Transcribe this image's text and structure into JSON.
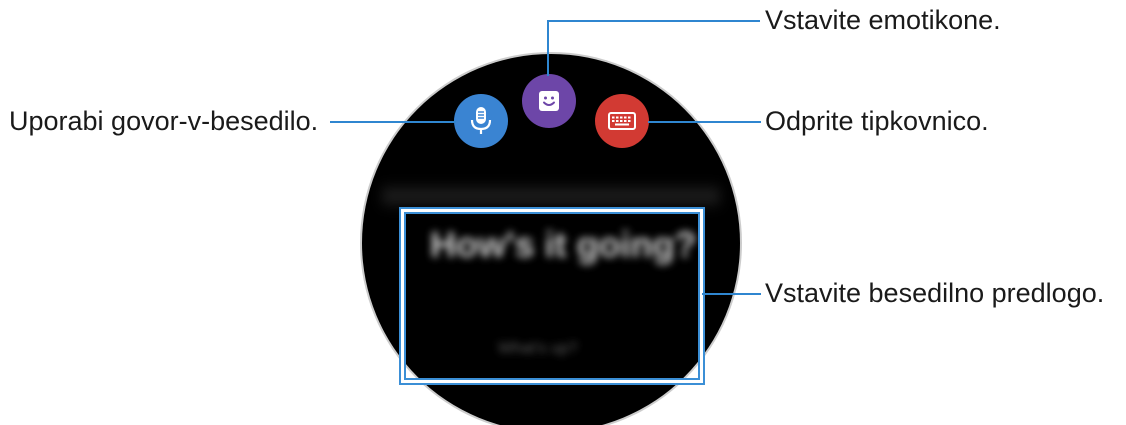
{
  "callouts": {
    "speech_to_text": "Uporabi govor-v-besedilo.",
    "emoticons": "Vstavite emotikone.",
    "keyboard": "Odprite tipkovnico.",
    "text_template": "Vstavite besedilno predlogo."
  },
  "watch_screen": {
    "template_message": "How's it going?",
    "template_message_2": "What's up?"
  },
  "colors": {
    "mic_button": "#3a84d2",
    "emoji_button": "#6d46a8",
    "keyboard_button": "#d23a33",
    "callout_line": "#2f86d0"
  },
  "icons": {
    "mic": "microphone-icon",
    "emoji": "smiley-icon",
    "keyboard": "keyboard-icon"
  }
}
